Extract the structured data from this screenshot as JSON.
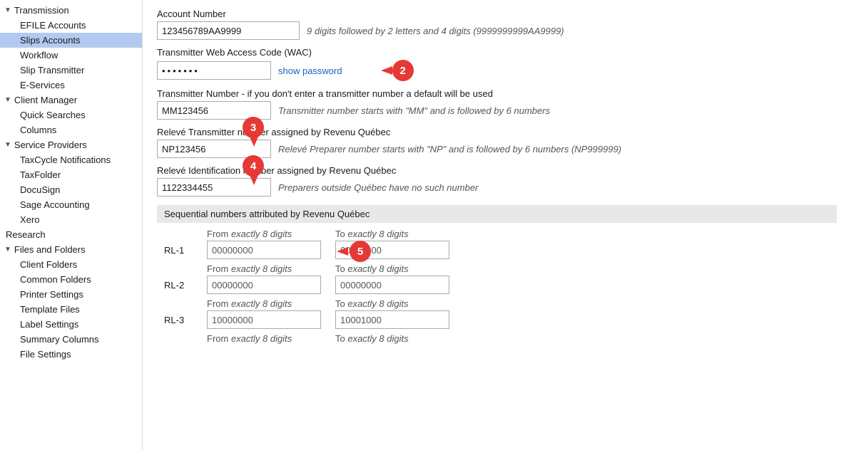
{
  "sidebar": {
    "sections": [
      {
        "type": "section",
        "label": "Transmission",
        "expanded": true,
        "children": [
          {
            "label": "EFILE Accounts",
            "selected": false,
            "indent": 1
          },
          {
            "label": "Slips Accounts",
            "selected": true,
            "indent": 1
          },
          {
            "label": "Workflow",
            "selected": false,
            "indent": 1
          },
          {
            "label": "Slip Transmitter",
            "selected": false,
            "indent": 1
          },
          {
            "label": "E-Services",
            "selected": false,
            "indent": 1
          }
        ]
      },
      {
        "type": "section",
        "label": "Client Manager",
        "expanded": true,
        "children": [
          {
            "label": "Quick Searches",
            "selected": false,
            "indent": 1
          },
          {
            "label": "Columns",
            "selected": false,
            "indent": 1
          }
        ]
      },
      {
        "type": "section",
        "label": "Service Providers",
        "expanded": true,
        "children": [
          {
            "label": "TaxCycle Notifications",
            "selected": false,
            "indent": 1
          },
          {
            "label": "TaxFolder",
            "selected": false,
            "indent": 1
          },
          {
            "label": "DocuSign",
            "selected": false,
            "indent": 1
          },
          {
            "label": "Sage Accounting",
            "selected": false,
            "indent": 1
          },
          {
            "label": "Xero",
            "selected": false,
            "indent": 1
          }
        ]
      },
      {
        "type": "item",
        "label": "Research",
        "selected": false,
        "indent": 0
      },
      {
        "type": "section",
        "label": "Files and Folders",
        "expanded": true,
        "children": [
          {
            "label": "Client Folders",
            "selected": false,
            "indent": 1
          },
          {
            "label": "Common Folders",
            "selected": false,
            "indent": 1
          },
          {
            "label": "Printer Settings",
            "selected": false,
            "indent": 1
          },
          {
            "label": "Template Files",
            "selected": false,
            "indent": 1
          },
          {
            "label": "Label Settings",
            "selected": false,
            "indent": 1
          },
          {
            "label": "Summary Columns",
            "selected": false,
            "indent": 1
          },
          {
            "label": "File Settings",
            "selected": false,
            "indent": 1
          }
        ]
      }
    ]
  },
  "main": {
    "account_number_label": "Account Number",
    "account_number_value": "123456789AA9999",
    "account_number_hint": "9 digits followed by 2 letters and 4 digits (9999999999AA9999)",
    "wac_label": "Transmitter Web Access Code (WAC)",
    "wac_password_dots": "●●●●●●●",
    "show_password_label": "show password",
    "transmitter_number_label": "Transmitter Number - if you don't enter a transmitter number a default will be used",
    "transmitter_number_value": "MM123456",
    "transmitter_number_hint": "Transmitter number starts with \"MM\" and is followed by 6 numbers",
    "releve_transmitter_label": "Relevé Transmitter number assigned by Revenu Québec",
    "releve_transmitter_value": "NP123456",
    "releve_transmitter_hint": "Relevé Preparer number starts with \"NP\" and is followed by 6 numbers (NP999999)",
    "releve_id_label": "Relevé Identification number assigned by Revenu Québec",
    "releve_id_value": "1122334455",
    "releve_id_hint": "Preparers outside Québec have no such number",
    "sequential_section_header": "Sequential numbers attributed by Revenu Québec",
    "from_label": "From",
    "from_hint": "exactly 8 digits",
    "to_label": "To",
    "to_hint": "exactly 8 digits",
    "sequential_rows": [
      {
        "label": "RL-1",
        "from_value": "00000000",
        "to_value": "00000000"
      },
      {
        "label": "RL-2",
        "from_value": "00000000",
        "to_value": "00000000"
      },
      {
        "label": "RL-3",
        "from_value": "10000000",
        "to_value": "10001000"
      }
    ],
    "badges": {
      "b2": "2",
      "b3": "3",
      "b4": "4",
      "b5": "5"
    }
  }
}
